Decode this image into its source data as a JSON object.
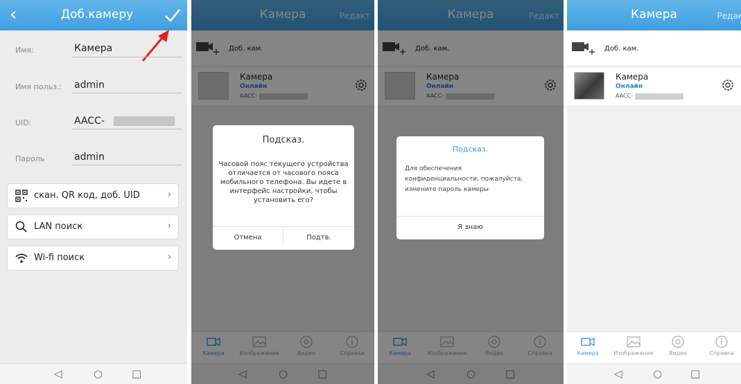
{
  "panel1": {
    "title": "Доб.камеру",
    "back_icon": "chevron-left-icon",
    "confirm_icon": "checkmark-icon",
    "fields": {
      "name": {
        "label": "Имя:",
        "value": "Камера"
      },
      "user": {
        "label": "Имя польз.:",
        "value": "admin"
      },
      "uid": {
        "label": "UID:",
        "value": "AACC-"
      },
      "password": {
        "label": "Пароль",
        "value": "admin"
      }
    },
    "menu": {
      "qr": {
        "label": "скан. QR код, доб. UID",
        "icon": "qr-code-icon"
      },
      "lan": {
        "label": "LAN поиск",
        "icon": "search-icon"
      },
      "wifi": {
        "label": "Wi-fi поиск",
        "icon": "wifi-icon"
      }
    },
    "chevron": "›"
  },
  "header": {
    "title": "Камера",
    "edit": "Редакт"
  },
  "camera_list": {
    "add_label": "Доб. кам.",
    "item": {
      "name": "Камера",
      "status": "Онлайн",
      "uid": "AACC-"
    }
  },
  "tabs": {
    "camera": "Камера",
    "images": "Изображение",
    "video": "Видео",
    "help": "Справка"
  },
  "dialog_timezone": {
    "title": "Подсказ.",
    "body": "Часовой пояс текущего устройства отличается от часового пояса мобильного телефона. Вы идете в интерфейс настройки, чтобы установить его?",
    "cancel": "Отмена",
    "confirm": "Подтв."
  },
  "dialog_password": {
    "title": "Подсказ.",
    "body": "Для обеспечения конфиденциальности, пожалуйста, измените пароль камеры",
    "ok": "Я знаю"
  },
  "nav": {
    "back": "◁",
    "home": "○",
    "recent": "□"
  },
  "colors": {
    "header": "#3f9ee0",
    "accent": "#3d9be0",
    "annotation_arrow": "#e02020",
    "status": "#2a7ad4"
  }
}
